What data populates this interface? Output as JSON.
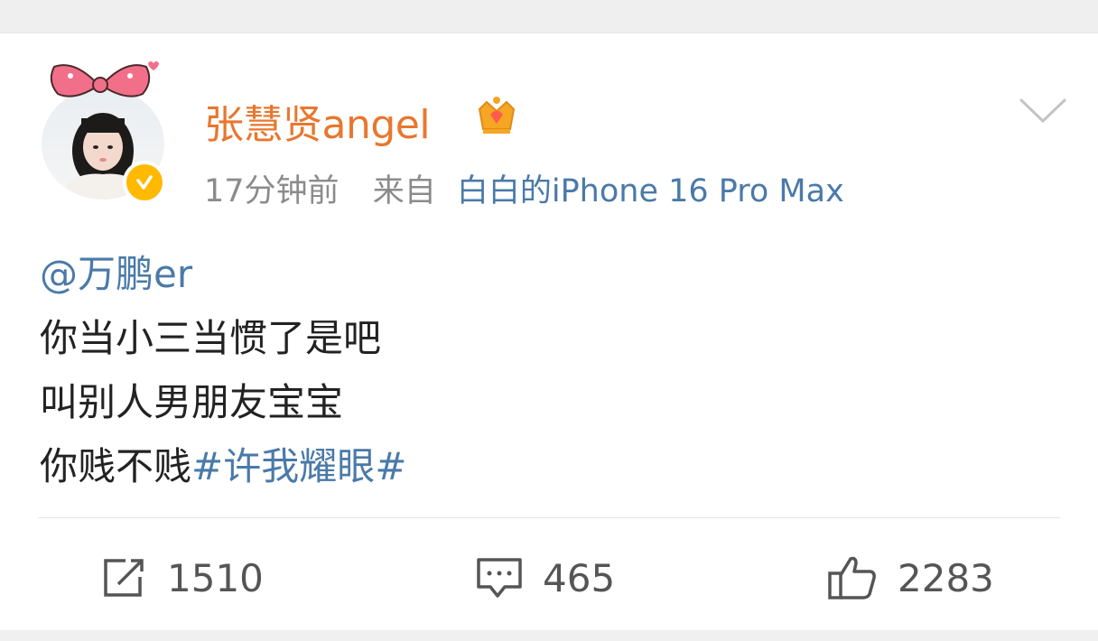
{
  "post": {
    "author": "张慧贤angel",
    "time": "17分钟前",
    "source_prefix": "来自",
    "device": "白白的iPhone 16 Pro Max",
    "content": {
      "mention": "@万鹏er",
      "line1": "你当小三当惯了是吧",
      "line2": "叫别人男朋友宝宝",
      "line3": "你贱不贱",
      "topic": "#许我耀眼#"
    }
  },
  "actions": {
    "repost_count": "1510",
    "comment_count": "465",
    "like_count": "2283"
  },
  "icons": {
    "verified": "verified-badge-icon",
    "crown": "vip-crown-icon",
    "more": "chevron-down-icon",
    "repost": "repost-icon",
    "comment": "comment-icon",
    "like": "thumbs-up-icon"
  },
  "colors": {
    "username": "#e8772e",
    "link": "#4a7aa8",
    "verified": "#ffb900"
  }
}
